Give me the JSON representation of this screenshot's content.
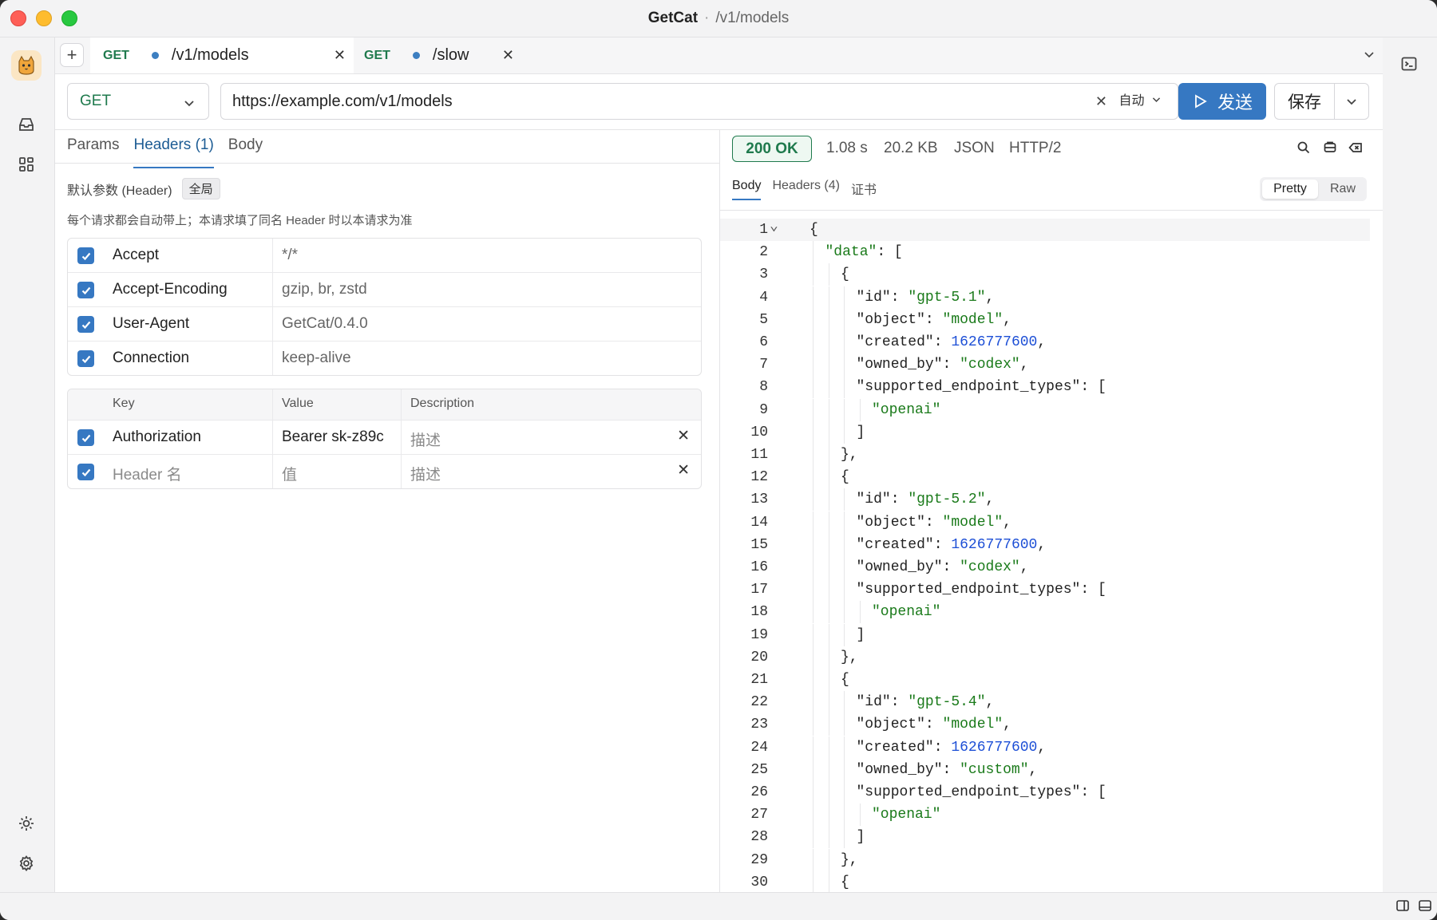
{
  "app": {
    "title": "GetCat",
    "separator": "·",
    "path": "/v1/models"
  },
  "tabs": [
    {
      "method": "GET",
      "path": "/v1/models"
    },
    {
      "method": "GET",
      "path": "/slow"
    }
  ],
  "request": {
    "method": "GET",
    "url": "https://example.com/v1/models",
    "mode": "自动",
    "send_label": "发送",
    "save_label": "保存"
  },
  "subtabs": [
    "Params",
    "Headers (1)",
    "Body"
  ],
  "default_headers": {
    "title": "默认参数 (Header)",
    "badge": "全局",
    "note": "每个请求都会自动带上；本请求填了同名 Header 时以本请求为准",
    "rows": [
      {
        "key": "Accept",
        "value": "*/*"
      },
      {
        "key": "Accept-Encoding",
        "value": "gzip, br, zstd"
      },
      {
        "key": "User-Agent",
        "value": "GetCat/0.4.0"
      },
      {
        "key": "Connection",
        "value": "keep-alive"
      }
    ]
  },
  "headers_table": {
    "columns": [
      "Key",
      "Value",
      "Description"
    ],
    "rows": [
      {
        "key": "Authorization",
        "value": "Bearer sk-z89c",
        "desc": "描述"
      },
      {
        "key": "Header 名",
        "value": "值",
        "desc": "描述"
      }
    ]
  },
  "response": {
    "status": "200 OK",
    "time": "1.08 s",
    "size": "20.2 KB",
    "type": "JSON",
    "protocol": "HTTP/2",
    "tabs": [
      "Body",
      "Headers (4)",
      "证书"
    ],
    "view_pretty": "Pretty",
    "view_raw": "Raw"
  },
  "code_lines": [
    {
      "n": "1",
      "indent": 0,
      "parts": [
        [
          "p",
          "{"
        ]
      ]
    },
    {
      "n": "2",
      "indent": 1,
      "parts": [
        [
          "str",
          "\"data\""
        ],
        [
          "p",
          ": ["
        ]
      ]
    },
    {
      "n": "3",
      "indent": 2,
      "parts": [
        [
          "p",
          "{"
        ]
      ]
    },
    {
      "n": "4",
      "indent": 3,
      "parts": [
        [
          "p",
          "\"id\": "
        ],
        [
          "str",
          "\"gpt-5.1\""
        ],
        [
          "p",
          ","
        ]
      ]
    },
    {
      "n": "5",
      "indent": 3,
      "parts": [
        [
          "p",
          "\"object\": "
        ],
        [
          "str",
          "\"model\""
        ],
        [
          "p",
          ","
        ]
      ]
    },
    {
      "n": "6",
      "indent": 3,
      "parts": [
        [
          "p",
          "\"created\": "
        ],
        [
          "num",
          "1626777600"
        ],
        [
          "p",
          ","
        ]
      ]
    },
    {
      "n": "7",
      "indent": 3,
      "parts": [
        [
          "p",
          "\"owned_by\": "
        ],
        [
          "str",
          "\"codex\""
        ],
        [
          "p",
          ","
        ]
      ]
    },
    {
      "n": "8",
      "indent": 3,
      "parts": [
        [
          "p",
          "\"supported_endpoint_types\": ["
        ]
      ]
    },
    {
      "n": "9",
      "indent": 4,
      "parts": [
        [
          "str",
          "\"openai\""
        ]
      ]
    },
    {
      "n": "10",
      "indent": 3,
      "parts": [
        [
          "p",
          "]"
        ]
      ]
    },
    {
      "n": "11",
      "indent": 2,
      "parts": [
        [
          "p",
          "},"
        ]
      ]
    },
    {
      "n": "12",
      "indent": 2,
      "parts": [
        [
          "p",
          "{"
        ]
      ]
    },
    {
      "n": "13",
      "indent": 3,
      "parts": [
        [
          "p",
          "\"id\": "
        ],
        [
          "str",
          "\"gpt-5.2\""
        ],
        [
          "p",
          ","
        ]
      ]
    },
    {
      "n": "14",
      "indent": 3,
      "parts": [
        [
          "p",
          "\"object\": "
        ],
        [
          "str",
          "\"model\""
        ],
        [
          "p",
          ","
        ]
      ]
    },
    {
      "n": "15",
      "indent": 3,
      "parts": [
        [
          "p",
          "\"created\": "
        ],
        [
          "num",
          "1626777600"
        ],
        [
          "p",
          ","
        ]
      ]
    },
    {
      "n": "16",
      "indent": 3,
      "parts": [
        [
          "p",
          "\"owned_by\": "
        ],
        [
          "str",
          "\"codex\""
        ],
        [
          "p",
          ","
        ]
      ]
    },
    {
      "n": "17",
      "indent": 3,
      "parts": [
        [
          "p",
          "\"supported_endpoint_types\": ["
        ]
      ]
    },
    {
      "n": "18",
      "indent": 4,
      "parts": [
        [
          "str",
          "\"openai\""
        ]
      ]
    },
    {
      "n": "19",
      "indent": 3,
      "parts": [
        [
          "p",
          "]"
        ]
      ]
    },
    {
      "n": "20",
      "indent": 2,
      "parts": [
        [
          "p",
          "},"
        ]
      ]
    },
    {
      "n": "21",
      "indent": 2,
      "parts": [
        [
          "p",
          "{"
        ]
      ]
    },
    {
      "n": "22",
      "indent": 3,
      "parts": [
        [
          "p",
          "\"id\": "
        ],
        [
          "str",
          "\"gpt-5.4\""
        ],
        [
          "p",
          ","
        ]
      ]
    },
    {
      "n": "23",
      "indent": 3,
      "parts": [
        [
          "p",
          "\"object\": "
        ],
        [
          "str",
          "\"model\""
        ],
        [
          "p",
          ","
        ]
      ]
    },
    {
      "n": "24",
      "indent": 3,
      "parts": [
        [
          "p",
          "\"created\": "
        ],
        [
          "num",
          "1626777600"
        ],
        [
          "p",
          ","
        ]
      ]
    },
    {
      "n": "25",
      "indent": 3,
      "parts": [
        [
          "p",
          "\"owned_by\": "
        ],
        [
          "str",
          "\"custom\""
        ],
        [
          "p",
          ","
        ]
      ]
    },
    {
      "n": "26",
      "indent": 3,
      "parts": [
        [
          "p",
          "\"supported_endpoint_types\": ["
        ]
      ]
    },
    {
      "n": "27",
      "indent": 4,
      "parts": [
        [
          "str",
          "\"openai\""
        ]
      ]
    },
    {
      "n": "28",
      "indent": 3,
      "parts": [
        [
          "p",
          "]"
        ]
      ]
    },
    {
      "n": "29",
      "indent": 2,
      "parts": [
        [
          "p",
          "},"
        ]
      ]
    },
    {
      "n": "30",
      "indent": 2,
      "parts": [
        [
          "p",
          "{"
        ]
      ]
    }
  ],
  "colors": {
    "accent": "#3678c2",
    "method": "#1f7a4d",
    "string": "#1a7a1a",
    "number": "#1d4fd6"
  },
  "icons": {
    "sidebar": [
      "logo-cat-icon",
      "inbox-icon",
      "grid-icon",
      "theme-icon",
      "settings-icon"
    ],
    "right": [
      "terminal-icon"
    ],
    "response": [
      "search-icon",
      "save-response-icon",
      "clear-icon"
    ]
  }
}
